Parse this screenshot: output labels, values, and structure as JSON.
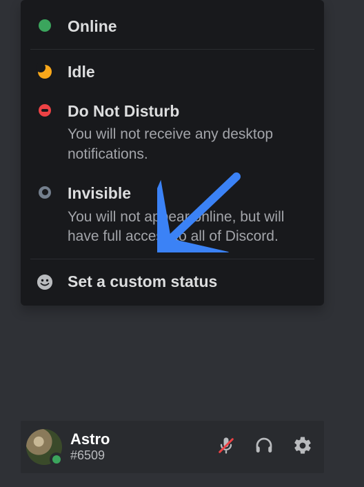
{
  "status_menu": {
    "online": {
      "label": "Online"
    },
    "idle": {
      "label": "Idle"
    },
    "dnd": {
      "label": "Do Not Disturb",
      "desc": "You will not receive any desktop notifications."
    },
    "invisible": {
      "label": "Invisible",
      "desc": "You will not appear online, but will have full access to all of Discord."
    },
    "custom": {
      "label": "Set a custom status"
    }
  },
  "user": {
    "name": "Astro",
    "discriminator": "#6509"
  }
}
